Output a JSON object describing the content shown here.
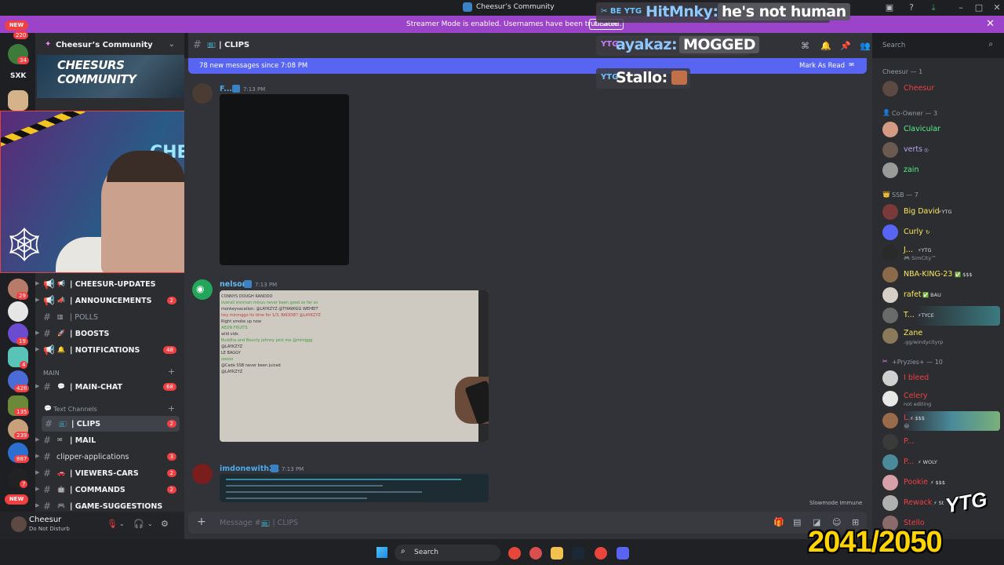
{
  "window": {
    "title": "Cheesur’s Community"
  },
  "streamer_bar": {
    "text": "Streamer Mode is enabled. Usernames have been truncated.",
    "disable_label": "Disable"
  },
  "server_rail": {
    "new_top": "NEW",
    "new_bottom": "NEW",
    "badges": [
      "220",
      "34",
      "29",
      "19",
      "4",
      "428",
      "135",
      "239",
      "887",
      "7"
    ],
    "text_items": [
      "SXK"
    ]
  },
  "guild": {
    "name": "Cheesur’s Community",
    "banner_text": "CHEESURS COMMUNITY"
  },
  "channels": [
    {
      "label": "| CHEESUR-UPDATES",
      "badge": ""
    },
    {
      "label": "| ANNOUNCEMENTS",
      "badge": "2"
    },
    {
      "label": "| POLLS",
      "badge": ""
    },
    {
      "label": "| BOOSTS",
      "badge": ""
    },
    {
      "label": "| NOTIFICATIONS",
      "badge": "48"
    }
  ],
  "category_main": "MAIN",
  "main_channels": [
    {
      "label": "| MAIN-CHAT",
      "badge": "68"
    }
  ],
  "category_text": "Text Channels",
  "text_channels": [
    {
      "label": "| CLIPS",
      "badge": "2"
    },
    {
      "label": "| MAIL",
      "badge": ""
    },
    {
      "label": "clipper-applications",
      "badge": "3"
    },
    {
      "label": "| VIEWERS-CARS",
      "badge": "2"
    },
    {
      "label": "| COMMANDS",
      "badge": "2"
    },
    {
      "label": "| GAME-SUGGESTIONS",
      "badge": ""
    }
  ],
  "user": {
    "name": "Cheesur",
    "status": "Do Not Disturb"
  },
  "chat": {
    "channel": "| CLIPS",
    "new_messages": "78 new messages since 7:08 PM",
    "mark_as_read": "Mark As Read",
    "messages": [
      {
        "author": "F...",
        "time": "7:13 PM"
      },
      {
        "author": "nelson",
        "time": "7:13 PM"
      },
      {
        "author": "imdonewith2k",
        "time": "7:13 PM"
      }
    ],
    "slowmode": "Slowmode Immune",
    "composer_placeholder": "Message #📺 | CLIPS"
  },
  "video_chat_lines": [
    "CONNYS DOUGH RANDDO",
    "overall ironman minus never been good so far so",
    "monkeyvacation: @LAYKZYZ @THAWIGG WEHEIT",
    "hey minmggo its time for 1/3, BADDIE? @LAYKZYZ",
    "Right smoke up now",
    "AEON FRUITS",
    "wild vids",
    "Buddha and Bounty johnny pick me @miniggg",
    "@LAYKZYZ",
    "LE BAGGY",
    "ooooo",
    "@Cade SSB never been juiced",
    "@LAYKZYZ"
  ],
  "search": {
    "placeholder": "Search"
  },
  "members": {
    "groups": [
      {
        "role": "Cheesur — 1",
        "members": [
          {
            "name": "Cheesur",
            "color": "#f23f42",
            "tag": "",
            "sub": ""
          }
        ]
      },
      {
        "role": "Co-Owner — 3",
        "members": [
          {
            "name": "Clavicular",
            "color": "#57f287",
            "tag": "",
            "sub": ""
          },
          {
            "name": "verts",
            "color": "#b9a4f5",
            "tag": "◎",
            "sub": ""
          },
          {
            "name": "zain",
            "color": "#57f287",
            "tag": "",
            "sub": ""
          }
        ]
      },
      {
        "role": "SSB — 7",
        "members": [
          {
            "name": "Big David",
            "color": "#fee75c",
            "tag": "⚡YTG",
            "sub": ""
          },
          {
            "name": "Curly",
            "color": "#fee75c",
            "tag": "↻",
            "sub": ""
          },
          {
            "name": "J...",
            "color": "#fee75c",
            "tag": "⚡YTG",
            "sub": "🎮 SimCity™"
          },
          {
            "name": "NBA-KING-23",
            "color": "#fee75c",
            "tag": "✅ $$$",
            "sub": ""
          },
          {
            "name": "rafet",
            "color": "#fee75c",
            "tag": "✅ BAU",
            "sub": ""
          },
          {
            "name": "T...",
            "color": "#fee75c",
            "tag": "⚡TYCE",
            "sub": ""
          },
          {
            "name": "Zane",
            "color": "#fee75c",
            "tag": "",
            "sub": ".gg/windycityrp"
          }
        ]
      },
      {
        "role": "+Pryzies+ — 10",
        "members": [
          {
            "name": "I bleed",
            "color": "#f23f42",
            "tag": "",
            "sub": ""
          },
          {
            "name": "Celery",
            "color": "#f23f42",
            "tag": "",
            "sub": "not editing"
          },
          {
            "name": "L...",
            "color": "#f23f42",
            "tag": "⚡ $$$",
            "sub": "😂"
          },
          {
            "name": "P...",
            "color": "#f23f42",
            "tag": "",
            "sub": ""
          },
          {
            "name": "P...",
            "color": "#f23f42",
            "tag": "⚡ WOLY",
            "sub": ""
          },
          {
            "name": "Pookie",
            "color": "#f23f42",
            "tag": "⚡ $$$",
            "sub": ""
          },
          {
            "name": "Rewack",
            "color": "#f23f42",
            "tag": "⚡ St",
            "sub": ""
          },
          {
            "name": "Stello",
            "color": "#f23f42",
            "tag": "",
            "sub": ""
          }
        ]
      }
    ]
  },
  "stream_overlay": {
    "messages": [
      {
        "badge": "✂ BE YTG",
        "user": "HitMnky:",
        "text": "he's not human"
      },
      {
        "badge": "YTG",
        "user": "ayakaz:",
        "text": "MOGGED"
      },
      {
        "badge": "YTG",
        "user": "Stallo:",
        "text": ""
      }
    ],
    "counter": "2041/2050",
    "logo": "YTG"
  },
  "taskbar": {
    "search": "Search"
  }
}
